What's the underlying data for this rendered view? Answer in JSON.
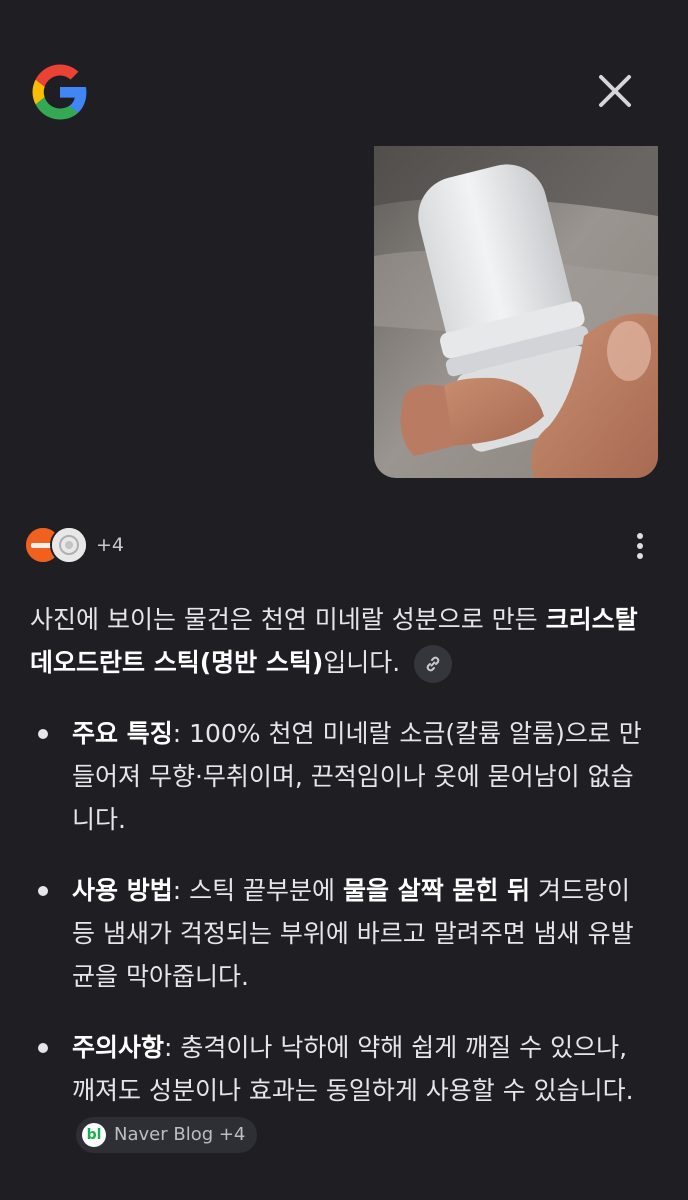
{
  "header": {
    "logo": "google-g-icon",
    "close_icon": "close-icon"
  },
  "photo": {
    "description_icon": "deodorant-stick-photo"
  },
  "sources": {
    "count_label": "+4"
  },
  "answer": {
    "intro_pre": "사진에 보이는 물건은 천연 미네랄 성분으로 만든 ",
    "intro_bold": "크리스탈 데오드란트 스틱(명반 스틱)",
    "intro_post": "입니다.",
    "bullets": [
      {
        "title": "주요 특징",
        "text": ": 100% 천연 미네랄 소금(칼륨 알룸)으로 만들어져 무향·무취이며, 끈적임이나 옷에 묻어남이 없습니다."
      },
      {
        "title": "사용 방법",
        "text_pre": ": 스틱 끝부분에 ",
        "text_bold": "물을 살짝 묻힌 뒤",
        "text_post": " 겨드랑이 등 냄새가 걱정되는 부위에 바르고 말려주면 냄새 유발균을 막아줍니다."
      },
      {
        "title": "주의사항",
        "text": ": 충격이나 낙하에 약해 쉽게 깨질 수 있으나, 깨져도 성분이나 효과는 동일하게 사용할 수 있습니다.",
        "citation": {
          "icon_text": "bl",
          "label": "Naver Blog +4"
        }
      }
    ]
  }
}
